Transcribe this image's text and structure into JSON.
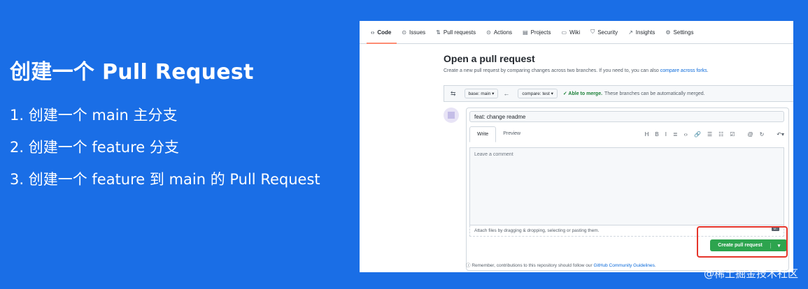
{
  "slide": {
    "title": "创建一个 Pull Request",
    "steps": [
      "1. 创建一个 main 主分支",
      "2. 创建一个 feature 分支",
      "3. 创建一个 feature 到 main 的 Pull Request"
    ]
  },
  "repo_nav": {
    "tabs": [
      {
        "label": "Code",
        "icon": "code-icon",
        "glyph": "‹›"
      },
      {
        "label": "Issues",
        "icon": "issue-icon",
        "glyph": "⊙"
      },
      {
        "label": "Pull requests",
        "icon": "pull-request-icon",
        "glyph": "⇅"
      },
      {
        "label": "Actions",
        "icon": "play-icon",
        "glyph": "⊙"
      },
      {
        "label": "Projects",
        "icon": "table-icon",
        "glyph": "▤"
      },
      {
        "label": "Wiki",
        "icon": "book-icon",
        "glyph": "▭"
      },
      {
        "label": "Security",
        "icon": "shield-icon",
        "glyph": "⛉"
      },
      {
        "label": "Insights",
        "icon": "graph-icon",
        "glyph": "↗"
      },
      {
        "label": "Settings",
        "icon": "gear-icon",
        "glyph": "⚙"
      }
    ]
  },
  "pr": {
    "heading": "Open a pull request",
    "subtext": "Create a new pull request by comparing changes across two branches. If you need to, you can also",
    "subtext_link": "compare across forks",
    "subtext_end": ".",
    "base_branch": "base: main ▾",
    "compare_branch": "compare: test ▾",
    "merge_status": "✓ Able to merge.",
    "merge_detail": "These branches can be automatically merged.",
    "title_value": "feat: change readme",
    "tab_write": "Write",
    "tab_preview": "Preview",
    "comment_placeholder": "Leave a comment",
    "attach_text": "Attach files by dragging & dropping, selecting or pasting them.",
    "markdown_badge": "M↓",
    "create_button": "Create pull request",
    "create_caret": "▾",
    "footnote_text": "Remember, contributions to this repository should follow our",
    "footnote_link": "GitHub Community Guidelines",
    "footnote_end": "."
  },
  "toolbar": [
    "H",
    "B",
    "I",
    "≣",
    "‹›",
    "🔗",
    "☰",
    "☷",
    "☑",
    "@",
    "↻",
    "↶▾"
  ],
  "watermark": "@稀土掘金技术社区",
  "colors": {
    "background": "#1a6ee6",
    "create_button": "#2da44e",
    "highlight": "#e5352b",
    "merge_ok": "#1a7f37",
    "link": "#0969da"
  }
}
